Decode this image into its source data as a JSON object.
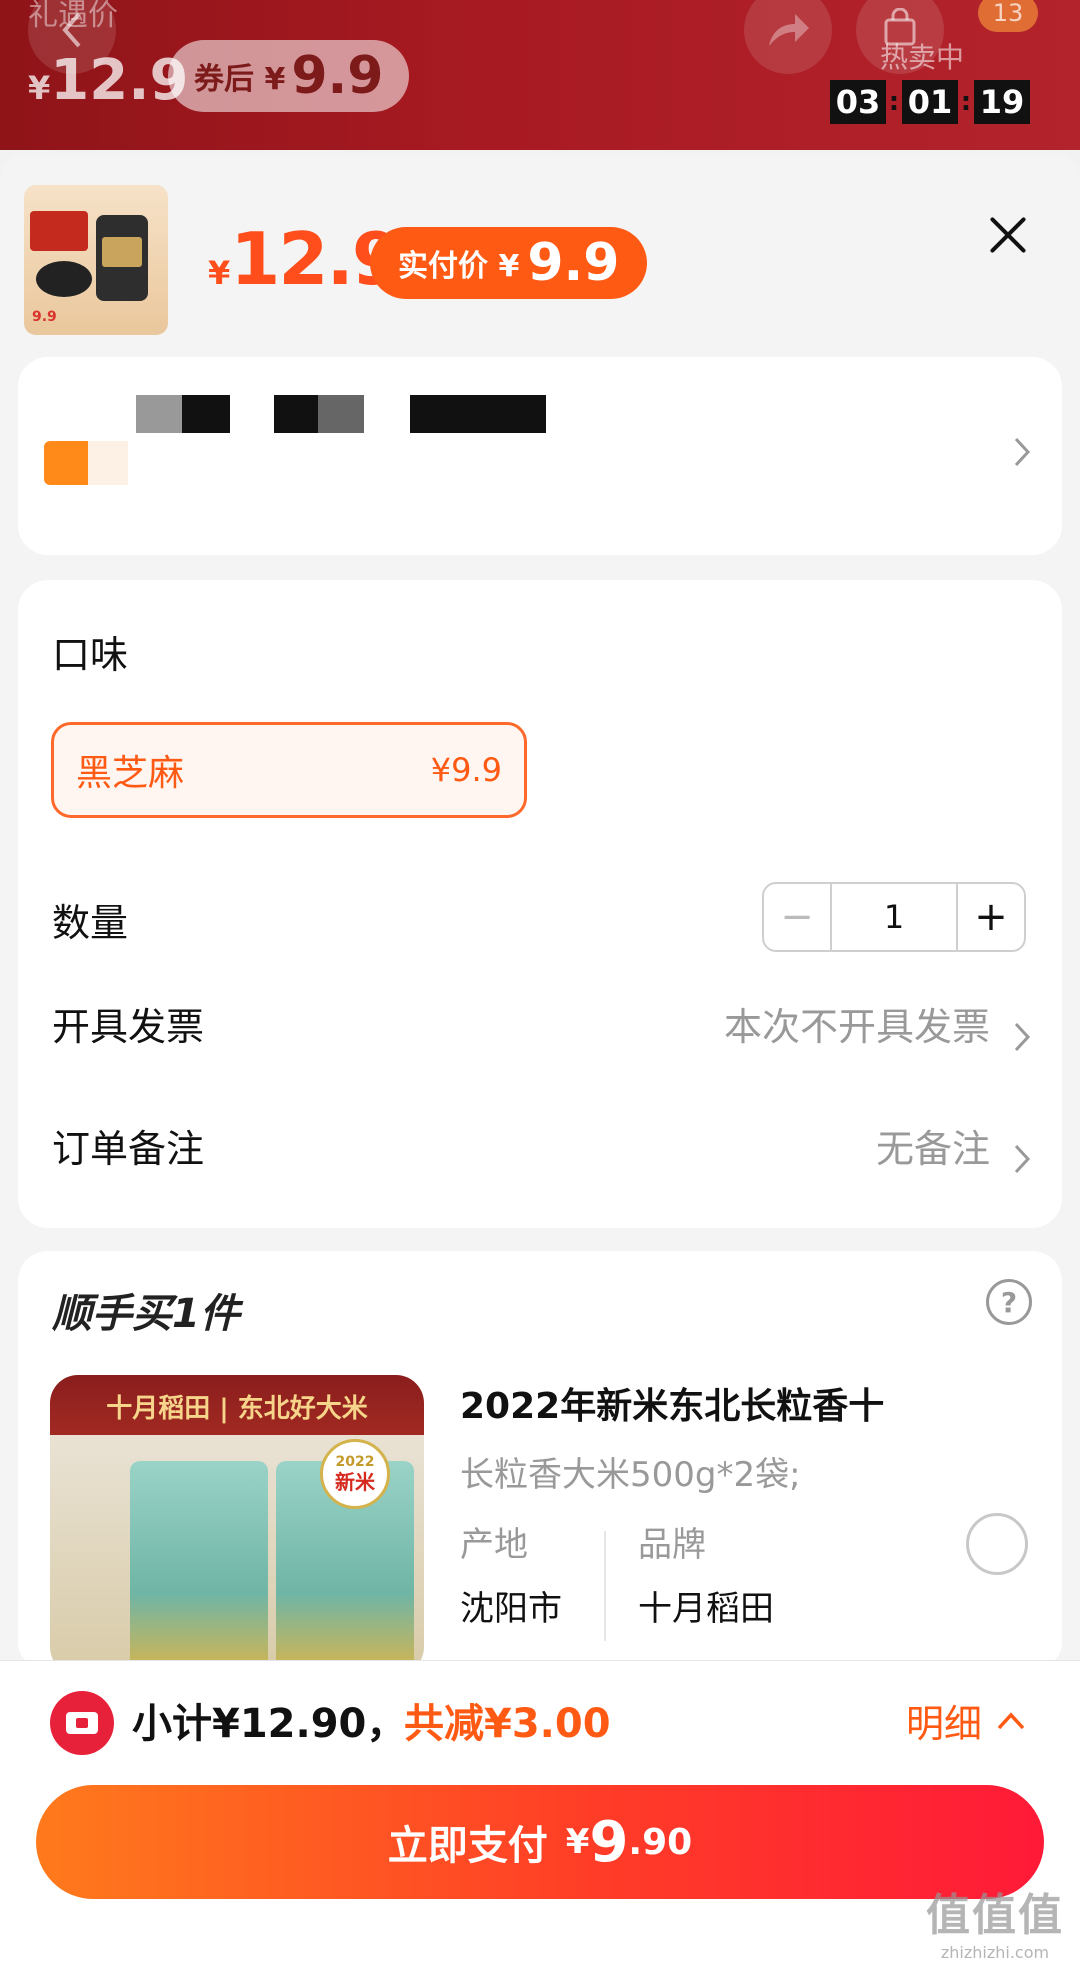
{
  "topbar": {
    "orig_label": "礼遇价",
    "orig_price_yen": "¥",
    "orig_price": "12.9",
    "coupon_label": "券后 ¥",
    "coupon_price": "9.9",
    "hot_label": "热卖中",
    "cart_count": "13",
    "timer": [
      "03",
      "01",
      "19"
    ]
  },
  "product": {
    "price_yen": "¥",
    "price": "12.9",
    "pay_label": "实付价 ¥",
    "pay_price": "9.9",
    "thumb_price": "9.9"
  },
  "options": {
    "flavor_label": "口味",
    "flavor_name": "黑芝麻",
    "flavor_price": "¥9.9",
    "qty_label": "数量",
    "qty_value": "1",
    "qty_minus": "−",
    "qty_plus": "+",
    "invoice_label": "开具发票",
    "invoice_value": "本次不开具发票",
    "note_label": "订单备注",
    "note_value": "无备注"
  },
  "upsell": {
    "title": "顺手买1件",
    "help": "?",
    "image_band": "十月稻田 | 东北好大米",
    "image_badge_year": "2022",
    "image_badge": "新米",
    "name": "2022年新米东北长粒香十",
    "spec": "长粒香大米500g*2袋;",
    "origin_label": "产地",
    "origin_value": "沈阳市",
    "brand_label": "品牌",
    "brand_value": "十月稻田"
  },
  "footer": {
    "subtotal": "小计¥12.90，",
    "saved": "共减¥3.00",
    "detail": "明细",
    "pay_label": "立即支付",
    "pay_yen": "¥",
    "pay_big": "9",
    "pay_small": ".90",
    "watermark": "值值值",
    "watermark_url": "zhizhizhi.com"
  },
  "colors": {
    "accent": "#ff5a14",
    "pay_gradient_start": "#ff7a1c",
    "pay_gradient_end": "#ff1a38",
    "topbar": "#a81a22"
  }
}
